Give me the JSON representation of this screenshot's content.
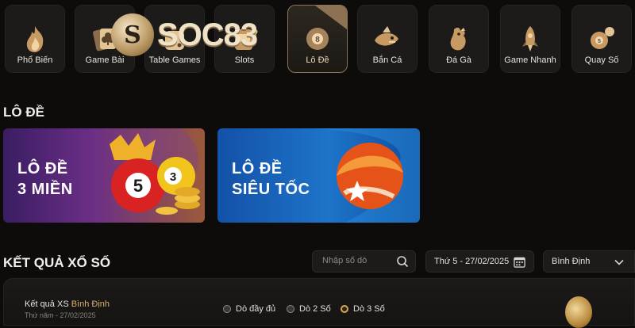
{
  "categories": [
    {
      "label": "Phổ Biến",
      "icon": "flame-icon",
      "active": false
    },
    {
      "label": "Game Bài",
      "icon": "card-clubs-icon",
      "active": false
    },
    {
      "label": "Table Games",
      "icon": "dice-icon",
      "active": false
    },
    {
      "label": "Slots",
      "icon": "slot-machine-icon",
      "active": false
    },
    {
      "label": "Lô Đề",
      "icon": "lottery-ball-icon",
      "active": true
    },
    {
      "label": "Bắn Cá",
      "icon": "fish-icon",
      "active": false
    },
    {
      "label": "Đá Gà",
      "icon": "rooster-icon",
      "active": false
    },
    {
      "label": "Game Nhanh",
      "icon": "rocket-icon",
      "active": false
    },
    {
      "label": "Quay Số",
      "icon": "number-balls-icon",
      "active": false
    }
  ],
  "logo": {
    "mark": "S",
    "word": "SOC83"
  },
  "lode_section": {
    "title": "LÔ ĐỀ",
    "banners": [
      {
        "line1": "LÔ ĐỀ",
        "line2": "3 MIỀN",
        "ball_number": "5",
        "ball_number2": "3"
      },
      {
        "line1": "LÔ ĐỀ",
        "line2": "SIÊU TỐC"
      }
    ]
  },
  "results": {
    "title": "KẾT QUẢ XỔ SỐ",
    "search_placeholder": "Nhập số dò",
    "date": "Thứ 5 - 27/02/2025",
    "province": "Bình Định",
    "card": {
      "label_prefix": "Kết quả XS",
      "province": "Bình Định",
      "sub": "Thứ năm - 27/02/2025",
      "options": [
        {
          "label": "Dò đầy đủ",
          "selected": false
        },
        {
          "label": "Dò 2 Số",
          "selected": false
        },
        {
          "label": "Dò 3 Số",
          "selected": true
        }
      ]
    }
  },
  "colors": {
    "background": "#0d0c0b",
    "accent_gold": "#d8a84e",
    "active_border": "#8a7458",
    "banner1": "#6c2f86",
    "banner2": "#1d74c9"
  }
}
